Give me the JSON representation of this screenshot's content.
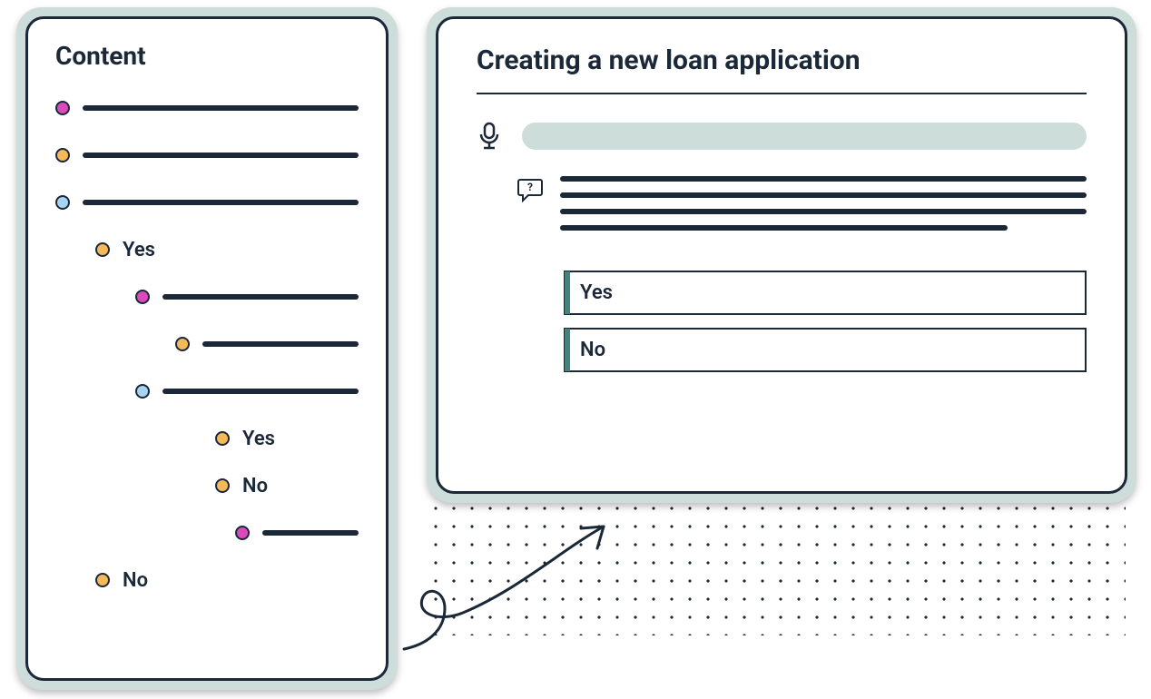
{
  "tree": {
    "title": "Content",
    "rows": [
      {
        "indent": 0,
        "dot": "magenta",
        "bar": true
      },
      {
        "indent": 0,
        "dot": "orange",
        "bar": true
      },
      {
        "indent": 0,
        "dot": "blue",
        "bar": true
      },
      {
        "indent": 1,
        "dot": "orange",
        "label": "Yes"
      },
      {
        "indent": 2,
        "dot": "magenta",
        "bar": true
      },
      {
        "indent": 3,
        "dot": "orange",
        "bar": true
      },
      {
        "indent": 2,
        "dot": "blue",
        "bar": true
      },
      {
        "indent": 4,
        "dot": "orange",
        "label": "Yes"
      },
      {
        "indent": 4,
        "dot": "orange",
        "label": "No"
      },
      {
        "indent": 5,
        "dot": "magenta",
        "bar": true
      },
      {
        "indent": 1,
        "dot": "orange",
        "label": "No"
      }
    ]
  },
  "main": {
    "title": "Creating a new loan application",
    "options": [
      "Yes",
      "No"
    ]
  },
  "colors": {
    "stroke": "#1b2838",
    "teal": "#cdddda",
    "accent": "#45817d",
    "magenta": "#d94bbd",
    "orange": "#f6b95a",
    "blue": "#a6d4f2"
  }
}
